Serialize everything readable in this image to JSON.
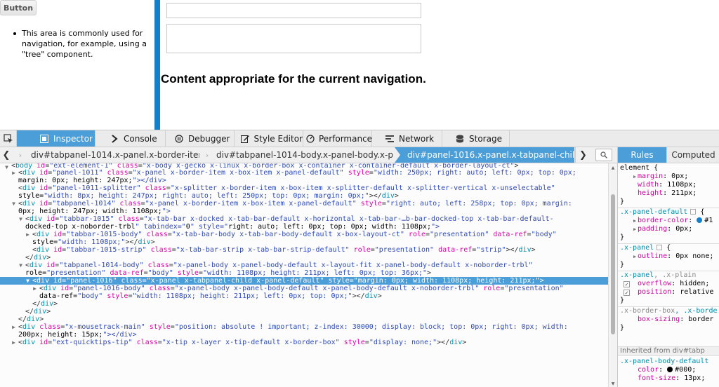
{
  "app": {
    "button_label": "Button",
    "nav_text": "This area is commonly used for navigation, for example, using a \"tree\" component.",
    "content_heading": "Content appropriate for the current navigation."
  },
  "devtools": {
    "tabs": [
      {
        "label": "Inspector",
        "icon": "inspector-icon",
        "active": true
      },
      {
        "label": "Console",
        "icon": "console-icon"
      },
      {
        "label": "Debugger",
        "icon": "debugger-icon"
      },
      {
        "label": "Style Editor",
        "icon": "style-editor-icon"
      },
      {
        "label": "Performance",
        "icon": "performance-icon"
      },
      {
        "label": "Network",
        "icon": "network-icon"
      },
      {
        "label": "Storage",
        "icon": "storage-icon"
      }
    ],
    "breadcrumbs": [
      "div#tabpanel-1014.x-panel.x-border-item....",
      "div#tabpanel-1014-body.x-panel-body.x-pa...",
      "div#panel-1016.x-panel.x-tabpanel-child...."
    ],
    "markup_lines": [
      "<body id=\"ext-element-1\" class=\"x-body x-gecko x-linux x-border-box x-container x-container-default x-border-layout-ct\">",
      "<div id=\"panel-1011\" class=\"x-panel x-border-item x-box-item x-panel-default\" style=\"width: 250px; right: auto; left: 0px; top: 0px;",
      "margin: 0px; height: 247px;\"></div>",
      "<div id=\"panel-1011-splitter\" class=\"x-splitter x-border-item x-box-item x-splitter-default x-splitter-vertical x-unselectable\"",
      "style=\"width: 8px; height: 247px; right: auto; left: 250px; top: 0px; margin: 0px;\"></div>",
      "<div id=\"tabpanel-1014\" class=\"x-panel x-border-item x-box-item x-panel-default\" style=\"right: auto; left: 258px; top: 0px; margin:",
      "0px; height: 247px; width: 1108px;\">",
      "<div id=\"tabbar-1015\" class=\"x-tab-bar x-docked x-tab-bar-default x-horizontal x-tab-bar-…b-bar-docked-top x-tab-bar-default-",
      "docked-top x-noborder-trbl\" tabindex=\"0\" style=\"right: auto; left: 0px; top: 0px; width: 1108px;\">",
      "<div id=\"tabbar-1015-body\" class=\"x-tab-bar-body x-tab-bar-body-default x-box-layout-ct\" role=\"presentation\" data-ref=\"body\"",
      "style=\"width: 1108px;\"></div>",
      "<div id=\"tabbar-1015-strip\" class=\"x-tab-bar-strip x-tab-bar-strip-default\" role=\"presentation\" data-ref=\"strip\"></div>",
      "</div>",
      "<div id=\"tabpanel-1014-body\" class=\"x-panel-body x-panel-body-default x-layout-fit x-panel-body-default x-noborder-trbl\"",
      "role=\"presentation\" data-ref=\"body\" style=\"width: 1108px; height: 211px; left: 0px; top: 36px;\">",
      "<div id=\"panel-1016\" class=\"x-panel x-tabpanel-child x-panel-default\" style=\"margin: 0px; width: 1108px; height: 211px;\">",
      "<div id=\"panel-1016-body\" class=\"x-panel-body x-panel-body-default x-panel-body-default x-noborder-trbl\" role=\"presentation\"",
      "data-ref=\"body\" style=\"width: 1108px; height: 211px; left: 0px; top: 0px;\"></div>",
      "</div>",
      "</div>",
      "</div>",
      "<div class=\"x-mousetrack-main\" style=\"position: absolute ! important; z-index: 30000; display: block; top: 0px; right: 0px; width:",
      "200px; height: 15px;\"></div>",
      "<div id=\"ext-quicktips-tip\" class=\"x-tip x-layer x-tip-default x-border-box\" style=\"display: none;\"></div>"
    ],
    "side_tabs": [
      "Rules",
      "Computed"
    ],
    "rules": {
      "element_selector": "element {",
      "element_props": [
        {
          "name": "margin",
          "value": "0px;"
        },
        {
          "name": "width",
          "value": "1108px;"
        },
        {
          "name": "height",
          "value": "211px;"
        }
      ],
      "r1_selector": ".x-panel-default",
      "r1_props": [
        {
          "name": "border-color",
          "value": "#1",
          "swatch": "#157fcc"
        },
        {
          "name": "padding",
          "value": "0px;"
        }
      ],
      "r2_selector": ".x-panel",
      "r2_props": [
        {
          "name": "outline",
          "value": "0px none;"
        }
      ],
      "r3_selector": ".x-panel",
      "r3_selector_extra": ", .x-plain",
      "r3_props": [
        {
          "name": "overflow",
          "value": "hidden;"
        },
        {
          "name": "position",
          "value": "relative"
        }
      ],
      "r4_selector": ".x-border-box",
      "r4_selector_extra": ", .x-borde",
      "r4_props": [
        {
          "name": "box-sizing",
          "value": "border"
        }
      ],
      "close_brace": "}",
      "open_brace": "{",
      "inherited_label": "Inherited from div#tabp",
      "r5_selector": ".x-panel-body-default",
      "r5_props": [
        {
          "name": "color",
          "value": "#000;",
          "swatch": "#000000"
        },
        {
          "name": "font-size",
          "value": "13px;"
        }
      ]
    }
  }
}
